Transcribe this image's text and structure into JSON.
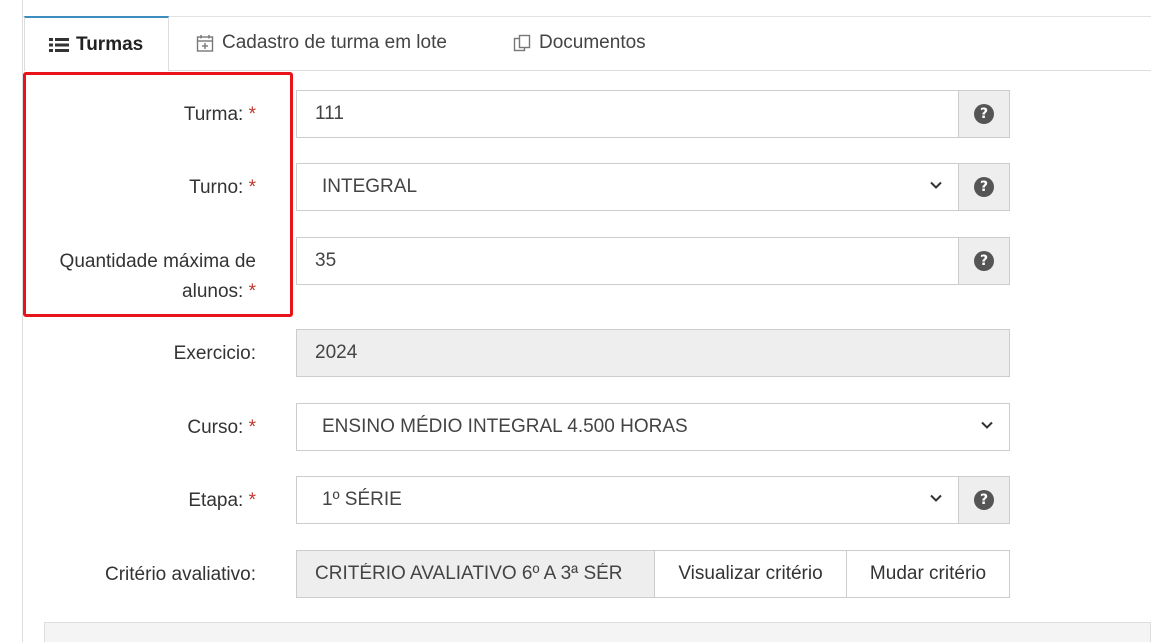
{
  "tabs": [
    {
      "label": "Turmas",
      "icon": "list-icon",
      "active": true
    },
    {
      "label": "Cadastro de turma em lote",
      "icon": "calendar-plus-icon",
      "active": false
    },
    {
      "label": "Documentos",
      "icon": "copy-icon",
      "active": false
    }
  ],
  "form": {
    "turma": {
      "label": "Turma:",
      "required": "*",
      "value": "111"
    },
    "turno": {
      "label": "Turno:",
      "required": "*",
      "value": "INTEGRAL"
    },
    "quantidade": {
      "label_line1": "Quantidade máxima de",
      "label_line2": "alunos:",
      "required": "*",
      "value": "35"
    },
    "exercicio": {
      "label": "Exercicio:",
      "value": "2024"
    },
    "curso": {
      "label": "Curso:",
      "required": "*",
      "value": "ENSINO MÉDIO INTEGRAL 4.500 HORAS"
    },
    "etapa": {
      "label": "Etapa:",
      "required": "*",
      "value": "1º SÉRIE"
    },
    "criterio": {
      "label": "Critério avaliativo:",
      "value": "CRITÉRIO AVALIATIVO 6º A 3ª SÉR",
      "view_button": "Visualizar critério",
      "change_button": "Mudar critério"
    }
  },
  "help_glyph": "?",
  "colors": {
    "highlight": "#e8141a",
    "active_tab_border": "#3c8dbc",
    "required": "#c0392b"
  }
}
